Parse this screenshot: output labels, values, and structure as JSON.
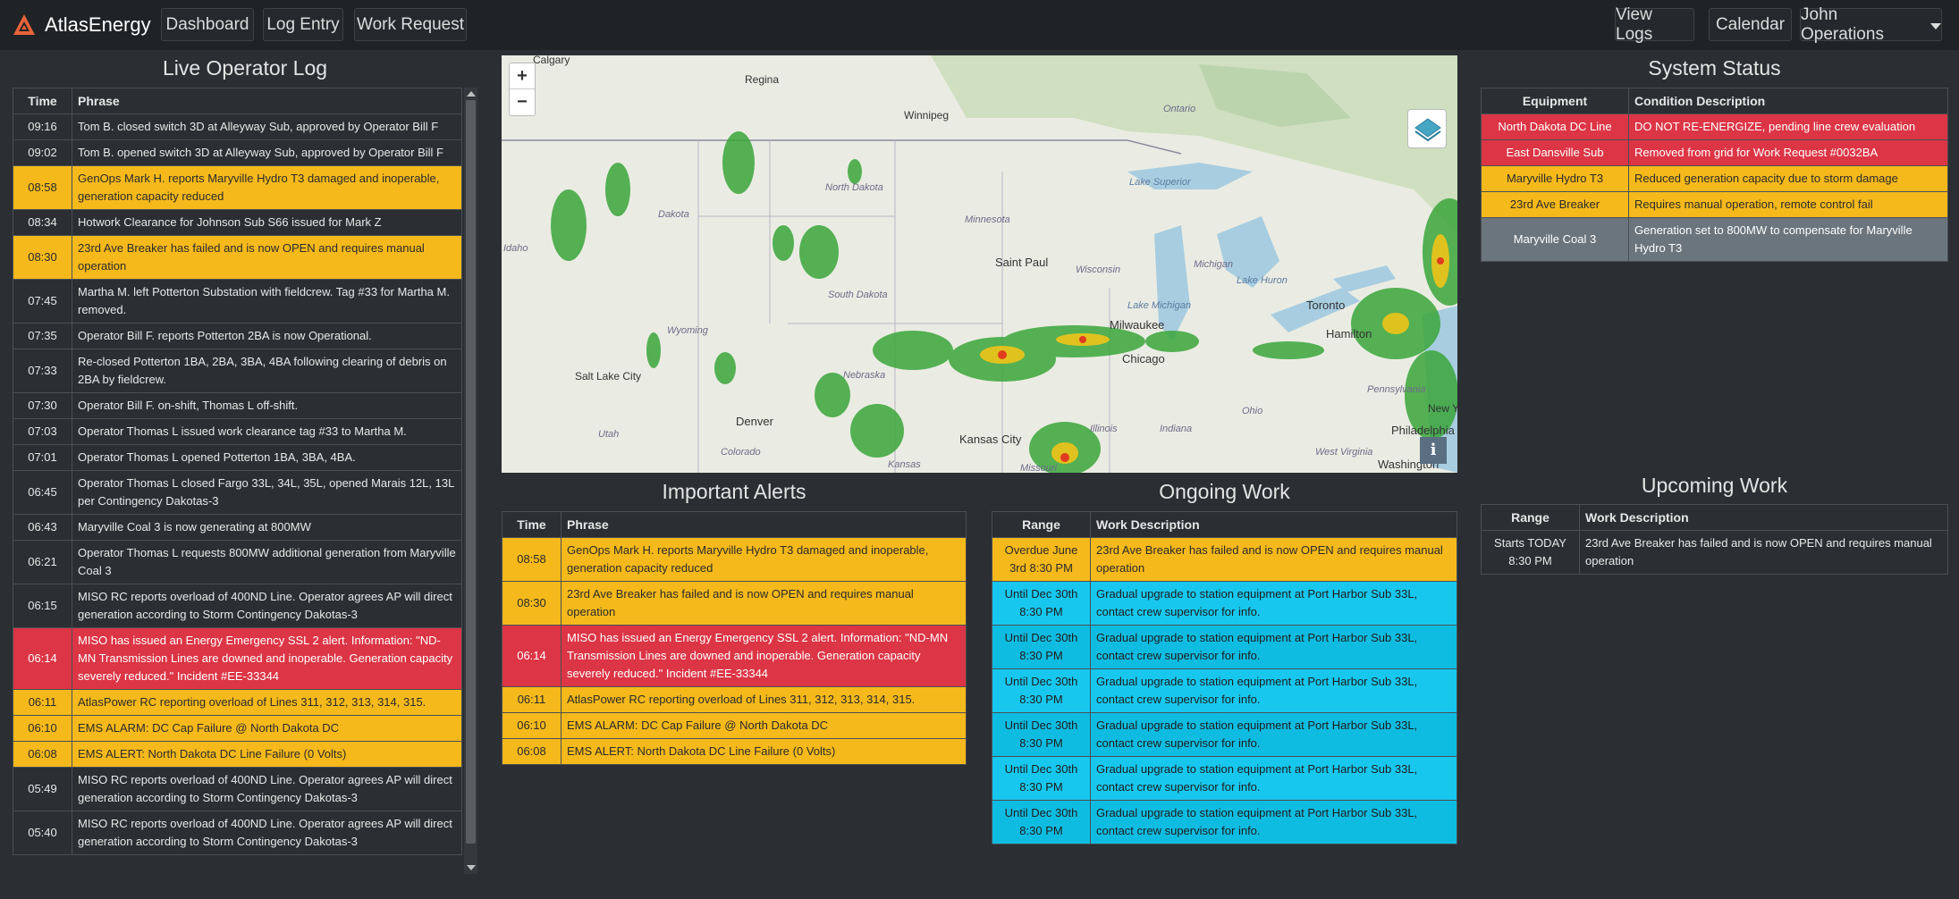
{
  "navbar": {
    "brand": "AtlasEnergy",
    "links": [
      "Dashboard",
      "Log Entry",
      "Work Request"
    ],
    "right_links": [
      "View Logs",
      "Calendar"
    ],
    "user": "John Operations"
  },
  "log": {
    "title": "Live Operator Log",
    "headers": [
      "Time",
      "Phrase"
    ],
    "rows": [
      {
        "time": "09:16",
        "phrase": "Tom B. closed switch 3D at Alleyway Sub, approved by Operator Bill F",
        "level": "normal"
      },
      {
        "time": "09:02",
        "phrase": "Tom B. opened switch 3D at Alleyway Sub, approved by Operator Bill F",
        "level": "normal"
      },
      {
        "time": "08:58",
        "phrase": "GenOps Mark H. reports Maryville Hydro T3 damaged and inoperable, generation capacity reduced",
        "level": "warn"
      },
      {
        "time": "08:34",
        "phrase": "Hotwork Clearance for Johnson Sub S66 issued for Mark Z",
        "level": "normal"
      },
      {
        "time": "08:30",
        "phrase": "23rd Ave Breaker has failed and is now OPEN and requires manual operation",
        "level": "warn"
      },
      {
        "time": "07:45",
        "phrase": "Martha M. left Potterton Substation with fieldcrew. Tag #33 for Martha M. removed.",
        "level": "normal"
      },
      {
        "time": "07:35",
        "phrase": "Operator Bill F. reports Potterton 2BA is now Operational.",
        "level": "normal"
      },
      {
        "time": "07:33",
        "phrase": "Re-closed Potterton 1BA, 2BA, 3BA, 4BA following clearing of debris on 2BA by fieldcrew.",
        "level": "normal"
      },
      {
        "time": "07:30",
        "phrase": "Operator Bill F. on-shift, Thomas L off-shift.",
        "level": "normal"
      },
      {
        "time": "07:03",
        "phrase": "Operator Thomas L issued work clearance tag #33 to Martha M.",
        "level": "normal"
      },
      {
        "time": "07:01",
        "phrase": "Operator Thomas L opened Potterton 1BA, 3BA, 4BA.",
        "level": "normal"
      },
      {
        "time": "06:45",
        "phrase": "Operator Thomas L closed Fargo 33L, 34L, 35L, opened Marais 12L, 13L per Contingency Dakotas-3",
        "level": "normal"
      },
      {
        "time": "06:43",
        "phrase": "Maryville Coal 3 is now generating at 800MW",
        "level": "normal"
      },
      {
        "time": "06:21",
        "phrase": "Operator Thomas L requests 800MW additional generation from Maryville Coal 3",
        "level": "normal"
      },
      {
        "time": "06:15",
        "phrase": "MISO RC reports overload of 400ND Line. Operator agrees AP will direct generation according to Storm Contingency Dakotas-3",
        "level": "normal"
      },
      {
        "time": "06:14",
        "phrase": "MISO has issued an Energy Emergency SSL 2 alert. Information: \"ND-MN Transmission Lines are downed and inoperable. Generation capacity severely reduced.\" Incident #EE-33344",
        "level": "danger"
      },
      {
        "time": "06:11",
        "phrase": "AtlasPower RC reporting overload of Lines 311, 312, 313, 314, 315.",
        "level": "warn"
      },
      {
        "time": "06:10",
        "phrase": "EMS ALARM: DC Cap Failure @ North Dakota DC",
        "level": "warn"
      },
      {
        "time": "06:08",
        "phrase": "EMS ALERT: North Dakota DC Line Failure (0 Volts)",
        "level": "warn"
      },
      {
        "time": "05:49",
        "phrase": "MISO RC reports overload of 400ND Line. Operator agrees AP will direct generation according to Storm Contingency Dakotas-3",
        "level": "normal"
      },
      {
        "time": "05:40",
        "phrase": "MISO RC reports overload of 400ND Line. Operator agrees AP will direct generation according to Storm Contingency Dakotas-3",
        "level": "normal"
      }
    ]
  },
  "map": {
    "labels": [
      "Calgary",
      "Regina",
      "Winnipeg",
      "Ontario",
      "North Dakota",
      "Minnesota",
      "Dakota",
      "Idaho",
      "Saint Paul",
      "Wisconsin",
      "Michigan",
      "Lake Superior",
      "South Dakota",
      "Wyoming",
      "Lake Michigan",
      "Lake Huron",
      "Toronto",
      "Milwaukee",
      "Hamilton",
      "Chicago",
      "Salt Lake City",
      "Nebraska",
      "Ohio",
      "Pennsylvania",
      "New York",
      "Denver",
      "Kansas City",
      "Illinois",
      "Indiana",
      "Utah",
      "Colorado",
      "Kansas",
      "Missouri",
      "Philadelphia",
      "Washington",
      "West Virginia"
    ],
    "zoom_in": "+",
    "zoom_out": "−",
    "info": "i"
  },
  "alerts": {
    "title": "Important Alerts",
    "headers": [
      "Time",
      "Phrase"
    ],
    "rows": [
      {
        "time": "08:58",
        "phrase": "GenOps Mark H. reports Maryville Hydro T3 damaged and inoperable, generation capacity reduced",
        "level": "warn"
      },
      {
        "time": "08:30",
        "phrase": "23rd Ave Breaker has failed and is now OPEN and requires manual operation",
        "level": "warn"
      },
      {
        "time": "06:14",
        "phrase": "MISO has issued an Energy Emergency SSL 2 alert. Information: \"ND-MN Transmission Lines are downed and inoperable. Generation capacity severely reduced.\" Incident #EE-33344",
        "level": "danger"
      },
      {
        "time": "06:11",
        "phrase": "AtlasPower RC reporting overload of Lines 311, 312, 313, 314, 315.",
        "level": "warn"
      },
      {
        "time": "06:10",
        "phrase": "EMS ALARM: DC Cap Failure @ North Dakota DC",
        "level": "warn"
      },
      {
        "time": "06:08",
        "phrase": "EMS ALERT: North Dakota DC Line Failure (0 Volts)",
        "level": "warn"
      }
    ]
  },
  "ongoing": {
    "title": "Ongoing Work",
    "headers": [
      "Range",
      "Work Description"
    ],
    "rows": [
      {
        "range": "Overdue June 3rd 8:30 PM",
        "desc": "23rd Ave Breaker has failed and is now OPEN and requires manual operation",
        "level": "warn"
      },
      {
        "range": "Until Dec 30th 8:30 PM",
        "desc": "Gradual upgrade to station equipment at Port Harbor Sub 33L, contact crew supervisor for info.",
        "level": "info"
      },
      {
        "range": "Until Dec 30th 8:30 PM",
        "desc": "Gradual upgrade to station equipment at Port Harbor Sub 33L, contact crew supervisor for info.",
        "level": "info2"
      },
      {
        "range": "Until Dec 30th 8:30 PM",
        "desc": "Gradual upgrade to station equipment at Port Harbor Sub 33L, contact crew supervisor for info.",
        "level": "info"
      },
      {
        "range": "Until Dec 30th 8:30 PM",
        "desc": "Gradual upgrade to station equipment at Port Harbor Sub 33L, contact crew supervisor for info.",
        "level": "info2"
      },
      {
        "range": "Until Dec 30th 8:30 PM",
        "desc": "Gradual upgrade to station equipment at Port Harbor Sub 33L, contact crew supervisor for info.",
        "level": "info"
      },
      {
        "range": "Until Dec 30th 8:30 PM",
        "desc": "Gradual upgrade to station equipment at Port Harbor Sub 33L, contact crew supervisor for info.",
        "level": "info2"
      }
    ]
  },
  "status": {
    "title": "System Status",
    "headers": [
      "Equipment",
      "Condition Description"
    ],
    "rows": [
      {
        "equipment": "North Dakota DC Line",
        "condition": "DO NOT RE-ENERGIZE, pending line crew evaluation",
        "level": "danger"
      },
      {
        "equipment": "East Dansville Sub",
        "condition": "Removed from grid for Work Request #0032BA",
        "level": "danger"
      },
      {
        "equipment": "Maryville Hydro T3",
        "condition": "Reduced generation capacity due to storm damage",
        "level": "warn"
      },
      {
        "equipment": "23rd Ave Breaker",
        "condition": "Requires manual operation, remote control fail",
        "level": "warn"
      },
      {
        "equipment": "Maryville Coal 3",
        "condition": "Generation set to 800MW to compensate for Maryville Hydro T3",
        "level": "gray"
      }
    ]
  },
  "upcoming": {
    "title": "Upcoming Work",
    "headers": [
      "Range",
      "Work Description"
    ],
    "rows": [
      {
        "range": "Starts TODAY 8:30 PM",
        "desc": "23rd Ave Breaker has failed and is now OPEN and requires manual operation",
        "level": "normal"
      }
    ]
  },
  "colors": {
    "background": "#2b2f33",
    "navbar": "#202326",
    "warn": "#f5b91b",
    "danger": "#dc3545",
    "info": "#17c7ee",
    "gray": "#6b757d",
    "brand_logo": "#e8633a"
  }
}
